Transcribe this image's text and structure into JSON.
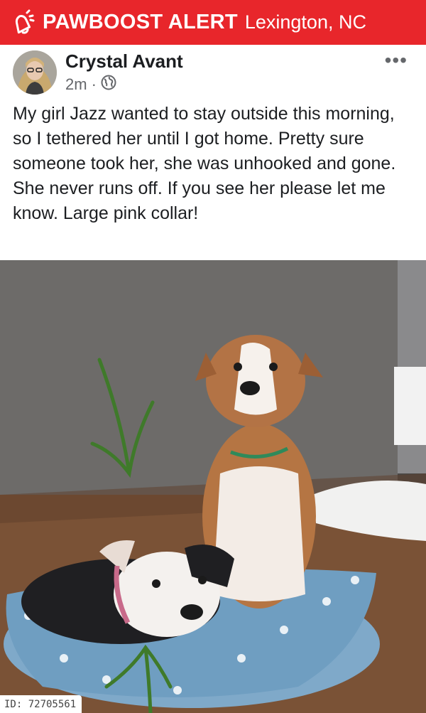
{
  "banner": {
    "brand": "PAWBOOST ALERT",
    "location": "Lexington, NC",
    "icon": "bell-icon",
    "color": "#e8262b"
  },
  "post": {
    "author": "Crystal Avant",
    "time": "2m",
    "separator": "·",
    "audience_icon": "globe-icon",
    "more_icon": "more-options-icon",
    "more_label": "•••",
    "text": "My girl Jazz wanted to stay outside this morning, so I tethered her until I got home. Pretty sure someone took her, she was unhooked and gone. She never runs off. If you see her please let me know. Large pink collar!"
  },
  "photo": {
    "id_label": "ID: 72705561"
  }
}
